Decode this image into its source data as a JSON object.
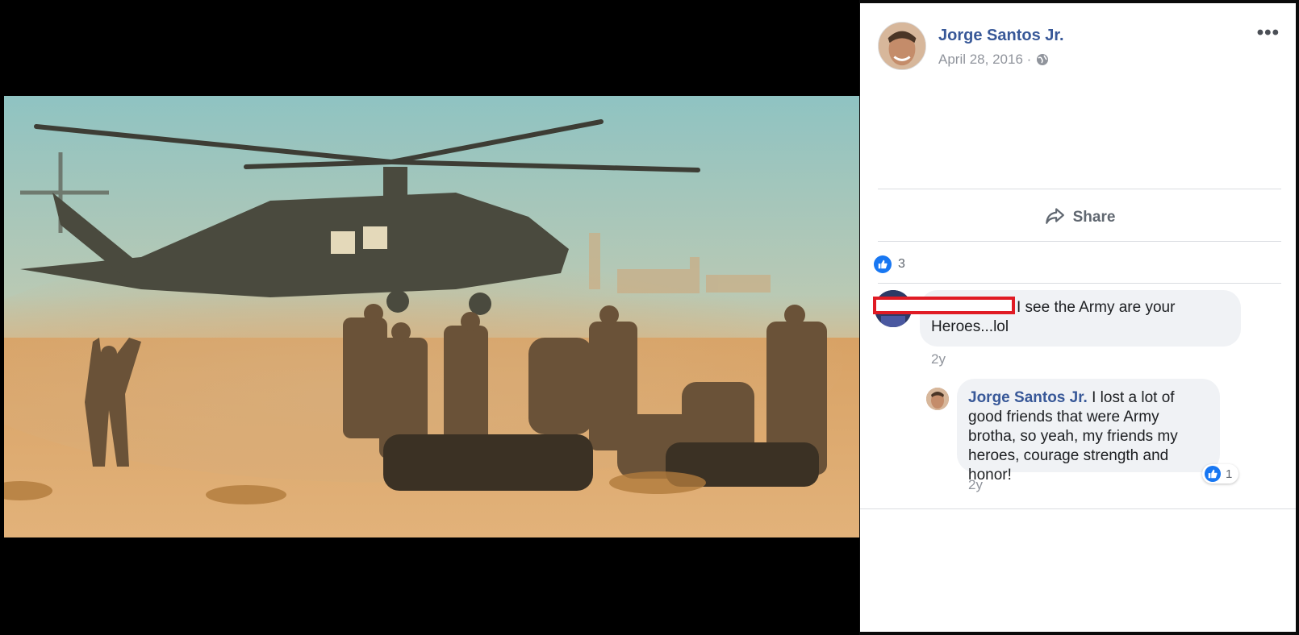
{
  "post": {
    "author": "Jorge Santos Jr.",
    "date": "April 28, 2016 ·",
    "privacy_icon": "globe-icon",
    "more_icon": "ellipsis-icon"
  },
  "actions": {
    "share_label": "Share",
    "share_icon": "share-arrow-icon"
  },
  "reactions": {
    "like_count": "3",
    "icon": "thumbs-up-icon"
  },
  "comments": [
    {
      "author": "",
      "author_redacted": true,
      "text": "I see the Army are your Heroes...lol",
      "time": "2y"
    }
  ],
  "reply": {
    "author": "Jorge Santos Jr.",
    "text": " I lost a lot of good friends that were Army brotha, so yeah, my friends my heroes, courage strength and honor!",
    "time": "2y",
    "like_count": "1"
  },
  "colors": {
    "link": "#385898",
    "like_blue": "#1877f2",
    "bubble_bg": "#f0f2f5",
    "redaction_red": "#e01b24"
  }
}
